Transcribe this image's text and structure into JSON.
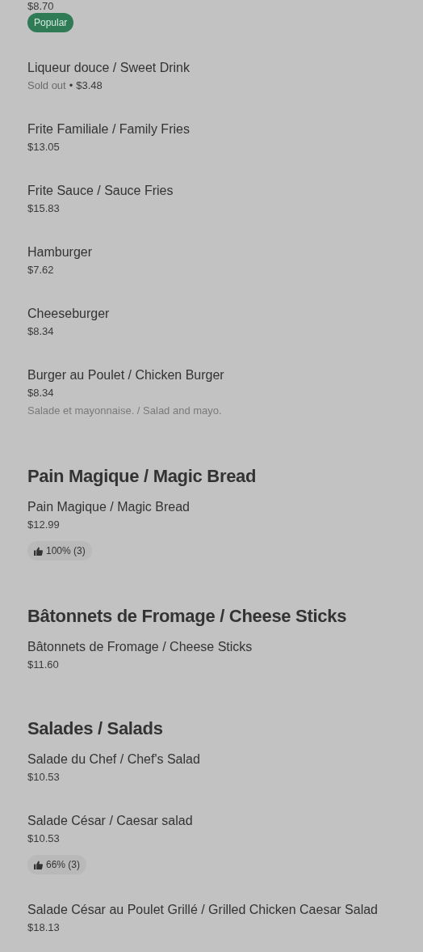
{
  "sections": [
    {
      "items": [
        {
          "price": "$8.70",
          "badges": [
            {
              "kind": "popular",
              "label": "Popular"
            }
          ]
        },
        {
          "name": "Liqueur douce / Sweet Drink",
          "status": "Sold out",
          "separator": "•",
          "price": "$3.48"
        },
        {
          "name": "Frite Familiale / Family Fries",
          "price": "$13.05"
        },
        {
          "name": "Frite Sauce / Sauce Fries",
          "price": "$15.83"
        },
        {
          "name": "Hamburger",
          "price": "$7.62"
        },
        {
          "name": "Cheeseburger",
          "price": "$8.34"
        },
        {
          "name": "Burger au Poulet / Chicken Burger",
          "price": "$8.34",
          "description": "Salade et mayonnaise. / Salad and mayo."
        }
      ]
    },
    {
      "title": "Pain Magique / Magic Bread",
      "items": [
        {
          "name": "Pain Magique / Magic Bread",
          "price": "$12.99",
          "badges": [
            {
              "kind": "rating",
              "label": "100% (3)"
            }
          ]
        }
      ]
    },
    {
      "title": "Bâtonnets de Fromage / Cheese Sticks",
      "items": [
        {
          "name": "Bâtonnets de Fromage / Cheese Sticks",
          "price": "$11.60"
        }
      ]
    },
    {
      "title": "Salades / Salads",
      "items": [
        {
          "name": "Salade du Chef / Chef's Salad",
          "price": "$10.53"
        },
        {
          "name": "Salade César / Caesar salad",
          "price": "$10.53",
          "badges": [
            {
              "kind": "rating",
              "label": "66% (3)"
            }
          ]
        },
        {
          "name": "Salade César au Poulet Grillé / Grilled Chicken Caesar Salad",
          "price": "$18.13"
        }
      ]
    }
  ]
}
